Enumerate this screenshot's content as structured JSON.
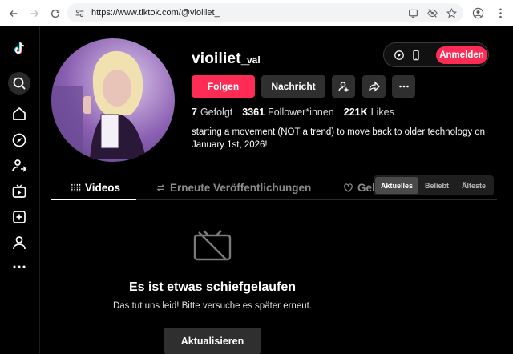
{
  "browser": {
    "url": "https://www.tiktok.com/@vioiliet_"
  },
  "profile": {
    "username": "vioiliet_",
    "nickname": "val",
    "follow_label": "Folgen",
    "message_label": "Nachricht",
    "stats": [
      {
        "value": "7",
        "label": "Gefolgt"
      },
      {
        "value": "3361",
        "label": "Follower*innen"
      },
      {
        "value": "221K",
        "label": "Likes"
      }
    ],
    "bio": "starting a movement (NOT a trend) to move back to older technology on January 1st, 2026!"
  },
  "header": {
    "login_label": "Anmelden"
  },
  "tabs": [
    {
      "label": "Videos",
      "icon": "grid-icon"
    },
    {
      "label": "Erneute Veröffentlichungen",
      "icon": "repost-icon"
    },
    {
      "label": "Gelikt",
      "icon": "heart-icon"
    }
  ],
  "sort": {
    "options": [
      "Aktuelles",
      "Beliebt",
      "Älteste"
    ],
    "selected": "Aktuelles"
  },
  "error": {
    "title": "Es ist etwas schiefgelaufen",
    "subtitle": "Das tut uns leid! Bitte versuche es später erneut.",
    "refresh_label": "Aktualisieren"
  },
  "colors": {
    "accent": "#fe2c55",
    "background": "#000000"
  }
}
